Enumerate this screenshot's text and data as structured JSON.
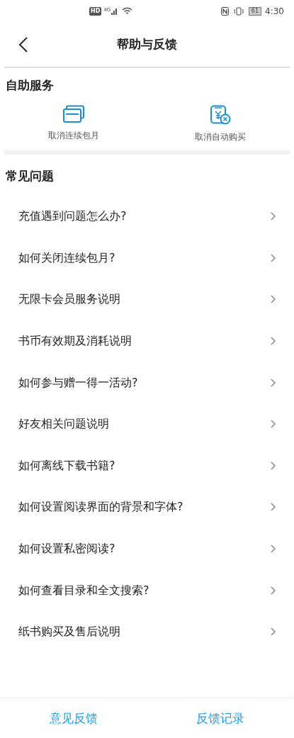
{
  "status_bar": {
    "hd": "HD",
    "network": "4G",
    "battery": "61",
    "time": "4:30"
  },
  "header": {
    "title": "帮助与反馈"
  },
  "self_service": {
    "title": "自助服务",
    "items": [
      {
        "kind": "card",
        "label": "取消连续包月"
      },
      {
        "kind": "receipt",
        "label": "取消自动购买"
      }
    ]
  },
  "faq": {
    "title": "常见问题",
    "items": [
      "充值遇到问题怎么办?",
      "如何关闭连续包月?",
      "无限卡会员服务说明",
      "书币有效期及消耗说明",
      "如何参与赠一得一活动?",
      "好友相关问题说明",
      "如何离线下载书籍?",
      "如何设置阅读界面的背景和字体?",
      "如何设置私密阅读?",
      "如何查看目录和全文搜索?",
      "纸书购买及售后说明"
    ]
  },
  "bottom_bar": [
    "意见反馈",
    "反馈记录"
  ]
}
